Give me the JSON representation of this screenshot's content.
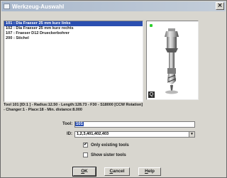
{
  "window": {
    "title": "Werkzeug-Auswahl",
    "close_label": "×"
  },
  "tool_list": {
    "items": [
      {
        "num": "101",
        "name": ": Dia Fraeser 25 mm kurz links",
        "selected": true
      },
      {
        "num": "102",
        "name": ": Dia Fraeser 25 mm kurz rechts",
        "selected": false
      },
      {
        "num": "107",
        "name": ": Fraeser  D12 Drueckerbohrer",
        "selected": false
      },
      {
        "num": "200",
        "name": ": Stichel",
        "selected": false
      }
    ]
  },
  "preview": {
    "icon": "tool-preview-image",
    "zoom_label": "Q",
    "indicator_color": "#2fd12f"
  },
  "status": {
    "line1": "Tool 101 [ID:1        ] - Radius:12.50 - Length:128.73 - F30 - S18000 [CCW Rotation]",
    "line2": "- Changer:1 - Place:18 - Min. distance:8.000"
  },
  "form": {
    "tool_label": "Tool:",
    "tool_value": "101",
    "id_label": "ID:",
    "id_value": "1,2,3,401,402,403",
    "combo_arrow": "▾",
    "only_existing_label": "Only existing tools",
    "only_existing_checked": "✔",
    "show_sister_label": "Show sister tools",
    "show_sister_checked": ""
  },
  "buttons": {
    "ok_u": "O",
    "ok_rest": "K",
    "cancel_u": "C",
    "cancel_rest": "ancel",
    "help_u": "H",
    "help_rest": "elp"
  },
  "colors": {
    "selection": "#2b4fb0",
    "dialog_bg": "#d8d6cf"
  }
}
